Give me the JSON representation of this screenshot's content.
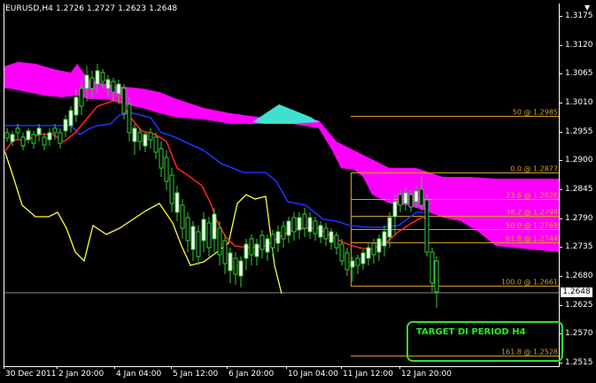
{
  "window": {
    "title": "EURUSD,H4  1.2726 1.2727 1.2623 1.2648",
    "corner_arrow": "▼"
  },
  "price_axis": {
    "labels": [
      "1.3175",
      "1.3120",
      "1.3065",
      "1.3010",
      "1.2955",
      "1.2900",
      "1.2845",
      "1.2790",
      "1.2735",
      "1.2680",
      "1.2625",
      "1.2570",
      "1.2515"
    ],
    "current_price": "1.2648"
  },
  "time_axis": {
    "labels": [
      "30 Dec 2011",
      "2 Jan 20:00",
      "4 Jan 04:00",
      "5 Jan 12:00",
      "6 Jan 20:00",
      "10 Jan 04:00",
      "11 Jan 12:00",
      "12 Jan 20:00"
    ]
  },
  "fibonacci": {
    "color": "#d4a020",
    "levels": [
      {
        "label": "50 @ 1.2985",
        "price": 1.2985
      },
      {
        "label": "0.0 @ 1.2877",
        "price": 1.2877
      },
      {
        "label": "23.6 @ 1.2826",
        "price": 1.2826
      },
      {
        "label": "38.2 @ 1.2794",
        "price": 1.2794
      },
      {
        "label": "50.0 @ 1.2769",
        "price": 1.2769
      },
      {
        "label": "61.8 @ 1.2744",
        "price": 1.2744
      },
      {
        "label": "100.0 @ 1.2661",
        "price": 1.2661
      },
      {
        "label": "161.8 @ 1.2528",
        "price": 1.2528
      }
    ]
  },
  "annotation": {
    "target_text": "TARGET DI PERIOD H4",
    "color": "#33dd33"
  },
  "colors": {
    "kumo_bear": "#ff00ff",
    "kumo_bull": "#40e0d0",
    "tenkan": "#ff2020",
    "kijun": "#2030ff",
    "chikou": "#ffff33",
    "candle": "#33cc33",
    "candle_bull_body": "#ffffff"
  }
}
